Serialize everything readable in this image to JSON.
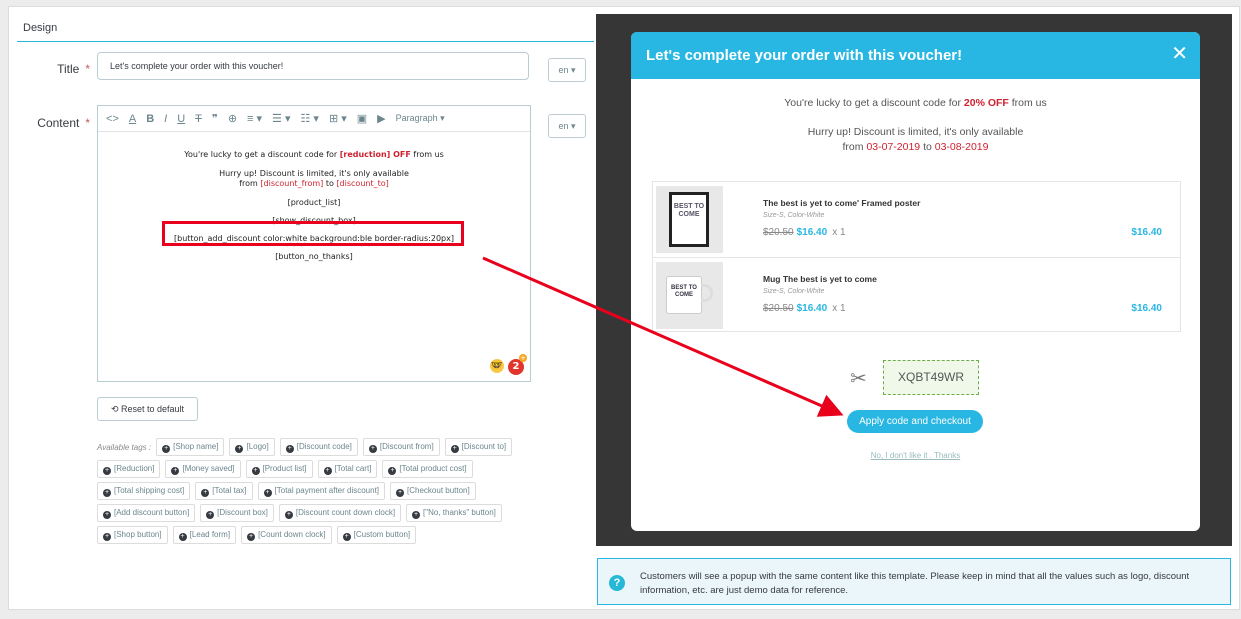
{
  "panel": {
    "heading": "Design"
  },
  "form": {
    "title_label": "Title",
    "title_required": "*",
    "title_value": "Let's complete your order with this voucher!",
    "title_lang": "en ▾",
    "content_label": "Content",
    "content_required": "*",
    "content_lang": "en ▾"
  },
  "toolbar": {
    "code": "<>",
    "font_color": "A",
    "bold": "B",
    "italic": "I",
    "underline": "U",
    "strike": "T",
    "quote": "❞",
    "link": "⊕",
    "align": "≡ ▾",
    "bullets": "☰ ▾",
    "numbers": "☷ ▾",
    "table": "⊞ ▾",
    "image": "▣",
    "media": "▶",
    "paragraph": "Paragraph ▾"
  },
  "editor": {
    "line1_pre": "You're lucky to get a discount code for ",
    "line1_tag": "[reduction] OFF",
    "line1_post": " from us",
    "line2": "Hurry up! Discount is limited, it's only available",
    "line3_pre": "from ",
    "line3_from": "[discount_from]",
    "line3_mid": " to ",
    "line3_to": "[discount_to]",
    "line4": "[product_list]",
    "line5": "[show_discount_box]",
    "line6_a": "[button_add_discount color:",
    "line6_b": "white",
    "line6_c": " background:",
    "line6_d": "ble",
    "line6_e": " border-radius:20px]",
    "line7": "[button_no_thanks]",
    "badge": "2",
    "badge_plus": "+",
    "emoji": "🤓"
  },
  "reset_label": "Reset to default",
  "reset_icon": "⟲",
  "tags": {
    "label": "Available tags :",
    "rows": [
      [
        "[Shop name]",
        "[Logo]",
        "[Discount code]",
        "[Discount from]",
        "[Discount to]"
      ],
      [
        "[Reduction]",
        "[Money saved]",
        "[Product list]",
        "[Total cart]",
        "[Total product cost]"
      ],
      [
        "[Total shipping cost]",
        "[Total tax]",
        "[Total payment after discount]",
        "[Checkout button]"
      ],
      [
        "[Add discount button]",
        "[Discount box]",
        "[Discount count down clock]",
        "[\"No, thanks\" button]"
      ],
      [
        "[Shop button]",
        "[Lead form]",
        "[Count down clock]",
        "[Custom button]"
      ]
    ]
  },
  "modal": {
    "title": "Let's complete your order with this voucher!",
    "close": "✕",
    "line1_pre": "You're lucky to get a discount code for ",
    "line1_bold": "20% OFF",
    "line1_post": " from us",
    "line2": "Hurry up! Discount is limited, it's only available",
    "line3_pre": "from ",
    "date_from": "03-07-2019",
    "line3_mid": " to ",
    "date_to": "03-08-2019",
    "products": [
      {
        "name": "The best is yet to come' Framed poster",
        "attr": "Size-S, Color-White",
        "old_price": "$20.50",
        "price": "$16.40",
        "qty": "x 1",
        "total": "$16.40",
        "img_text": "BEST TO COME"
      },
      {
        "name": "Mug The best is yet to come",
        "attr": "Size-S, Color-White",
        "old_price": "$20.50",
        "price": "$16.40",
        "qty": "x 1",
        "total": "$16.40",
        "img_text": "BEST TO COME"
      }
    ],
    "scissors": "✂",
    "code": "XQBT49WR",
    "apply_label": "Apply code and checkout",
    "no_thanks": "No, I don't like it . Thanks"
  },
  "info": {
    "icon": "?",
    "text": "Customers will see a popup with the same content like this template. Please keep in mind that all the values such as logo, discount information, etc. are just demo data for reference."
  },
  "colors": {
    "accent": "#28b6e2",
    "highlight": "#e8001c",
    "tag_red": "#d0222f"
  }
}
